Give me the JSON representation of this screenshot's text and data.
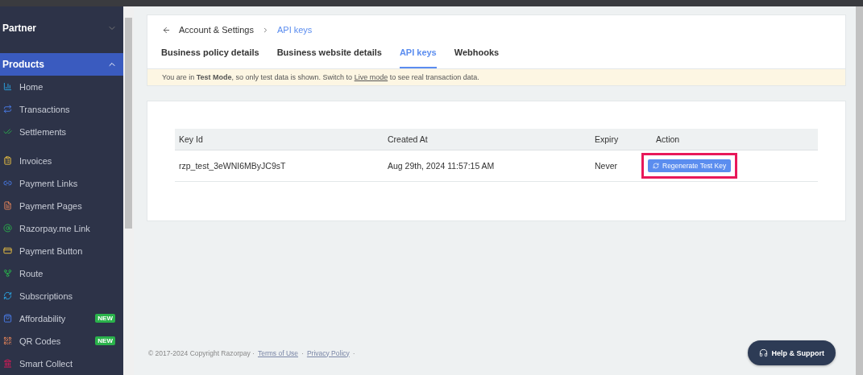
{
  "sidebar": {
    "sections": [
      {
        "label": "Partner",
        "expanded": false,
        "selected": false
      },
      {
        "label": "Products",
        "expanded": true,
        "selected": true
      }
    ],
    "groups": [
      [
        {
          "label": "Home"
        },
        {
          "label": "Transactions"
        },
        {
          "label": "Settlements"
        }
      ],
      [
        {
          "label": "Invoices"
        },
        {
          "label": "Payment Links"
        },
        {
          "label": "Payment Pages"
        },
        {
          "label": "Razorpay.me Link"
        },
        {
          "label": "Payment Button"
        },
        {
          "label": "Route"
        },
        {
          "label": "Subscriptions"
        },
        {
          "label": "Affordability",
          "badge": "NEW"
        },
        {
          "label": "QR Codes",
          "badge": "NEW"
        },
        {
          "label": "Smart Collect"
        }
      ]
    ]
  },
  "breadcrumb": {
    "parent": "Account & Settings",
    "current": "API keys"
  },
  "tabs": [
    {
      "label": "Business policy details",
      "selected": false
    },
    {
      "label": "Business website details",
      "selected": false
    },
    {
      "label": "API keys",
      "selected": true
    },
    {
      "label": "Webhooks",
      "selected": false
    }
  ],
  "banner": {
    "text": "You are in **Test Mode**, so only test data is shown. Switch to",
    "link": "Live mode",
    "after": "to see real transaction data."
  },
  "table": {
    "columns": [
      "Key Id",
      "Created At",
      "Expiry",
      "Action"
    ],
    "rows": [
      {
        "key_id": "rzp_test_3eWNI6MByJC9sT",
        "created_at": "Aug 29th, 2024 11:57:15 AM",
        "expiry": "Never",
        "action": {
          "label": "Regenerate Test Key",
          "highlighted": true
        }
      }
    ]
  },
  "footer": {
    "copyright": "© 2017-2024 Copyright Razorpay ·",
    "links": [
      "Terms of Use",
      "Privacy Policy"
    ],
    "separator": "·"
  },
  "help_button": "Help & Support"
}
